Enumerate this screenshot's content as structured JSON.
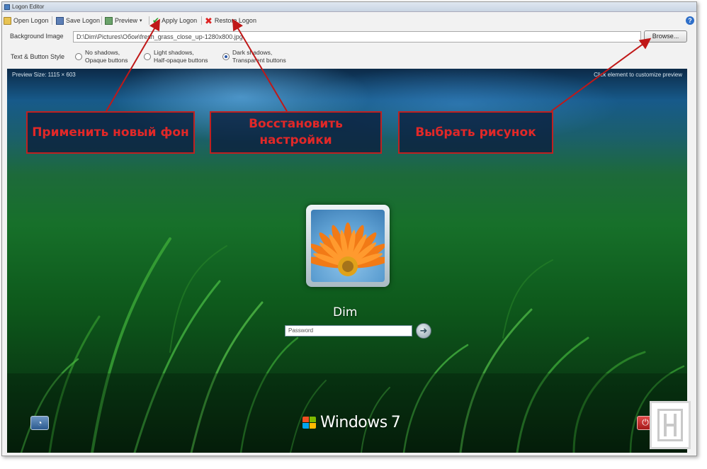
{
  "window": {
    "title": "Logon Editor"
  },
  "toolbar": {
    "open_label": "Open Logon",
    "save_label": "Save Logon",
    "preview_label": "Preview",
    "apply_label": "Apply Logon",
    "restore_label": "Restore Logon",
    "help_glyph": "?"
  },
  "background": {
    "label": "Background Image",
    "path": "D:\\Dim\\Pictures\\Обои\\fresh_grass_close_up-1280x800.jpg",
    "browse_label": "Browse..."
  },
  "text_style": {
    "label": "Text & Button Style",
    "options": [
      {
        "line1": "No shadows,",
        "line2": "Opaque buttons",
        "checked": false
      },
      {
        "line1": "Light shadows,",
        "line2": "Half-opaque buttons",
        "checked": false
      },
      {
        "line1": "Dark shadows,",
        "line2": "Transparent buttons",
        "checked": true
      }
    ]
  },
  "preview": {
    "size_label": "Preview Size: 1115 × 603",
    "hint": "Click element to customize preview",
    "user_name": "Dim",
    "password_placeholder": "Password",
    "go_glyph": "➜",
    "brand_text": "Windows",
    "brand_version": "7",
    "ease_glyph": "◔",
    "power_glyph": "⏻",
    "power_arrow_glyph": "▸"
  },
  "callouts": {
    "apply": "Применить новый фон",
    "restore": "Восстановить настройки",
    "browse": "Выбрать рисунок"
  },
  "colors": {
    "callout_border": "#c02020",
    "callout_text": "#e12828",
    "grass_green": "#17702a",
    "sky_blue": "#175a8a"
  }
}
